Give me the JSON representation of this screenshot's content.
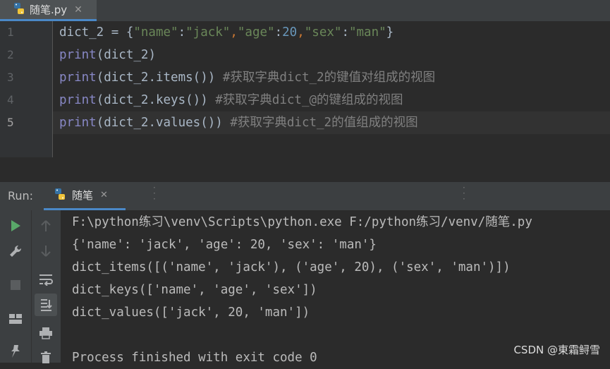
{
  "editor_tab": {
    "label": "随笔.py",
    "close": "✕"
  },
  "editor": {
    "line_numbers": [
      "1",
      "2",
      "3",
      "4",
      "5"
    ],
    "lines": [
      {
        "l1_a": "dict_2 = {",
        "l1_b": "\"name\"",
        "l1_c": ":",
        "l1_d": "\"jack\"",
        "l1_e": ",",
        "l1_f": "\"age\"",
        "l1_g": ":",
        "l1_h": "20",
        "l1_i": ",",
        "l1_j": "\"sex\"",
        "l1_k": ":",
        "l1_l": "\"man\"",
        "l1_m": "}"
      },
      {
        "kw": "print",
        "rest": "(dict_2)"
      },
      {
        "kw": "print",
        "rest": "(dict_2.items()) ",
        "comment": "#获取字典dict_2的键值对组成的视图"
      },
      {
        "kw": "print",
        "rest": "(dict_2.keys()) ",
        "comment": "#获取字典dict_@的键组成的视图"
      },
      {
        "kw": "print",
        "rest": "(dict_2.values()) ",
        "comment": "#获取字典dict_2的值组成的视图"
      }
    ]
  },
  "run_panel": {
    "title": "Run:",
    "tab_label": "随笔",
    "close": "✕"
  },
  "console": {
    "lines": [
      "F:\\python练习\\venv\\Scripts\\python.exe F:/python练习/venv/随笔.py",
      "{'name': 'jack', 'age': 20, 'sex': 'man'}",
      "dict_items([('name', 'jack'), ('age', 20), ('sex', 'man')])",
      "dict_keys(['name', 'age', 'sex'])",
      "dict_values(['jack', 20, 'man'])",
      "",
      "Process finished with exit code 0"
    ]
  },
  "watermark": "CSDN @東霜鲟雪",
  "colors": {
    "keyword": "#8888c6",
    "string": "#6a8759",
    "number": "#6897bb",
    "comment": "#808080",
    "accent": "#4a88c7",
    "run_green": "#59a869"
  },
  "icons": [
    "python-file-icon",
    "run-icon",
    "wrench-icon",
    "stop-icon",
    "layout-icon",
    "pin-icon",
    "up-arrow-icon",
    "down-arrow-icon",
    "soft-wrap-icon",
    "scroll-to-end-icon",
    "print-icon",
    "trash-icon"
  ]
}
